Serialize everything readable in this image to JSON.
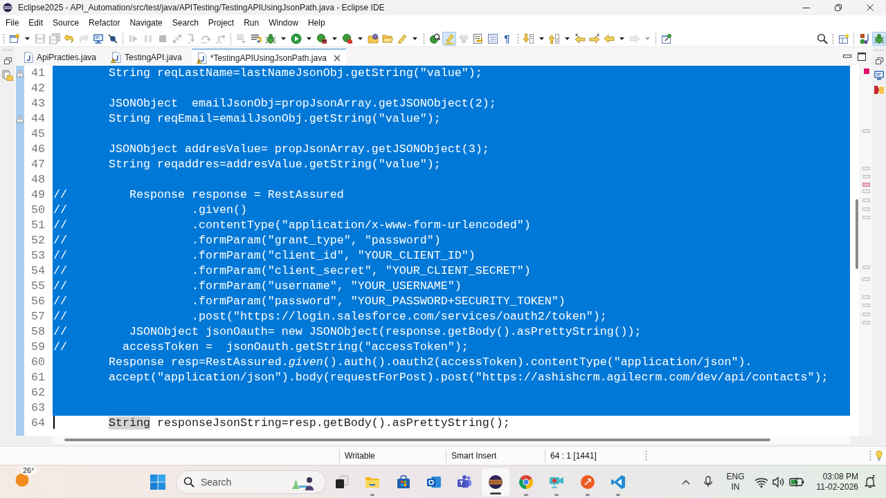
{
  "window": {
    "title": "Eclipse2025 - API_Automation/src/test/java/APITesting/TestingAPIUsingJsonPath.java - Eclipse IDE"
  },
  "menu": [
    "File",
    "Edit",
    "Source",
    "Refactor",
    "Navigate",
    "Search",
    "Project",
    "Run",
    "Window",
    "Help"
  ],
  "toolbar": {
    "sections": [
      {
        "groups": [
          [
            {
              "kind": "new",
              "disabled": false,
              "pressed": false
            },
            {
              "kind": "caret",
              "disabled": false,
              "pressed": false
            },
            {
              "kind": "save",
              "disabled": true,
              "pressed": false
            },
            {
              "kind": "saveall",
              "disabled": true,
              "pressed": false
            },
            {
              "kind": "undo",
              "disabled": false,
              "pressed": false
            },
            {
              "kind": "redo",
              "disabled": true,
              "pressed": false
            },
            {
              "kind": "terminal",
              "disabled": false,
              "pressed": false
            },
            {
              "kind": "skipbreakpoints",
              "disabled": false,
              "pressed": false
            }
          ],
          [
            {
              "kind": "resume",
              "disabled": true,
              "pressed": false
            },
            {
              "kind": "suspend",
              "disabled": true,
              "pressed": false
            },
            {
              "kind": "terminate",
              "disabled": true,
              "pressed": false
            },
            {
              "kind": "disconnect",
              "disabled": true,
              "pressed": false
            },
            {
              "kind": "stepinto",
              "disabled": true,
              "pressed": false
            },
            {
              "kind": "stepover",
              "disabled": true,
              "pressed": false
            },
            {
              "kind": "stepreturn",
              "disabled": true,
              "pressed": false
            }
          ],
          [
            {
              "kind": "stepfilters",
              "disabled": true,
              "pressed": false
            },
            {
              "kind": "dropframe",
              "disabled": false,
              "pressed": false
            },
            {
              "kind": "debug",
              "disabled": false,
              "pressed": false
            },
            {
              "kind": "caret",
              "disabled": false,
              "pressed": false
            },
            {
              "kind": "run",
              "disabled": false,
              "pressed": false
            },
            {
              "kind": "caret",
              "disabled": false,
              "pressed": false
            },
            {
              "kind": "coverage",
              "disabled": false,
              "pressed": false
            },
            {
              "kind": "caret",
              "disabled": false,
              "pressed": false
            },
            {
              "kind": "tools",
              "disabled": false,
              "pressed": false
            },
            {
              "kind": "caret",
              "disabled": false,
              "pressed": false
            },
            {
              "kind": "newpackage",
              "disabled": false,
              "pressed": false
            },
            {
              "kind": "openfolder",
              "disabled": false,
              "pressed": false
            },
            {
              "kind": "pen",
              "disabled": false,
              "pressed": false
            },
            {
              "kind": "caret",
              "disabled": false,
              "pressed": false
            }
          ]
        ]
      },
      {
        "groups": [
          [
            {
              "kind": "task",
              "disabled": false,
              "pressed": false
            },
            {
              "kind": "highlight",
              "disabled": false,
              "pressed": true
            },
            {
              "kind": "balls",
              "disabled": true,
              "pressed": false
            },
            {
              "kind": "wordwrap",
              "disabled": false,
              "pressed": false
            },
            {
              "kind": "blockselect",
              "disabled": false,
              "pressed": false
            },
            {
              "kind": "pilcrow",
              "disabled": false,
              "pressed": false,
              "label": "¶"
            }
          ]
        ]
      },
      {
        "groups": [
          [
            {
              "kind": "nextannotation",
              "disabled": false,
              "pressed": false
            },
            {
              "kind": "caret",
              "disabled": false,
              "pressed": false
            },
            {
              "kind": "previousannotation",
              "disabled": false,
              "pressed": false
            },
            {
              "kind": "caret",
              "disabled": false,
              "pressed": false
            },
            {
              "kind": "lastedit",
              "disabled": false,
              "pressed": false
            },
            {
              "kind": "nextedit",
              "disabled": false,
              "pressed": false
            },
            {
              "kind": "back",
              "disabled": false,
              "pressed": false
            },
            {
              "kind": "caret",
              "disabled": false,
              "pressed": false
            },
            {
              "kind": "forward",
              "disabled": true,
              "pressed": false
            },
            {
              "kind": "caret",
              "disabled": true,
              "pressed": false
            }
          ],
          [
            {
              "kind": "pin",
              "disabled": false,
              "pressed": false
            }
          ]
        ]
      }
    ],
    "search": {
      "kind": "search",
      "disabled": false,
      "pressed": false
    },
    "perspectives": {
      "groups": [
        [
          {
            "kind": "perspective",
            "disabled": false,
            "pressed": false
          }
        ],
        [
          {
            "kind": "javaperspective",
            "disabled": false,
            "pressed": false
          },
          {
            "kind": "debugperspective",
            "disabled": false,
            "pressed": true
          }
        ]
      ]
    }
  },
  "editor_tabs": [
    {
      "label": "ApiPracties.java",
      "selected": false,
      "warning": false
    },
    {
      "label": "TestingAPI.java",
      "selected": false,
      "warning": true
    },
    {
      "label": "*TestingAPIUsingJsonPath.java",
      "selected": true,
      "warning": true
    }
  ],
  "editor": {
    "lines": [
      {
        "number": "41",
        "selected": true,
        "warning": true,
        "caret": false,
        "occurrence": false,
        "code": "        String reqLastName=lastNameJsonObj.getString(\"value\");"
      },
      {
        "number": "42",
        "selected": true,
        "warning": false,
        "caret": false,
        "occurrence": false
      },
      {
        "number": "43",
        "selected": true,
        "warning": false,
        "caret": false,
        "occurrence": false,
        "code": "        JSONObject  emailJsonObj=propJsonArray.getJSONObject(2);"
      },
      {
        "number": "44",
        "selected": true,
        "warning": true,
        "caret": false,
        "occurrence": false,
        "code": "        String reqEmail=emailJsonObj.getString(\"value\");"
      },
      {
        "number": "45",
        "selected": true,
        "warning": false,
        "caret": false,
        "occurrence": false
      },
      {
        "number": "46",
        "selected": true,
        "warning": false,
        "caret": false,
        "occurrence": false,
        "code": "        JSONObject addresValue= propJsonArray.getJSONObject(3);"
      },
      {
        "number": "47",
        "selected": true,
        "warning": false,
        "caret": false,
        "occurrence": false,
        "code": "        String reqaddres=addresValue.getString(\"value\");"
      },
      {
        "number": "48",
        "selected": true,
        "warning": false,
        "caret": false,
        "occurrence": false
      },
      {
        "number": "49",
        "selected": true,
        "warning": false,
        "caret": false,
        "occurrence": false,
        "code": "//         Response response = RestAssured"
      },
      {
        "number": "50",
        "selected": true,
        "warning": false,
        "caret": false,
        "occurrence": false,
        "code": "//                  .given()"
      },
      {
        "number": "51",
        "selected": true,
        "warning": false,
        "caret": false,
        "occurrence": false,
        "code": "//                  .contentType(\"application/x-www-form-urlencoded\")"
      },
      {
        "number": "52",
        "selected": true,
        "warning": false,
        "caret": false,
        "occurrence": false,
        "code": "//                  .formParam(\"grant_type\", \"password\")"
      },
      {
        "number": "53",
        "selected": true,
        "warning": false,
        "caret": false,
        "occurrence": false,
        "code": "//                  .formParam(\"client_id\", \"YOUR_CLIENT_ID\")"
      },
      {
        "number": "54",
        "selected": true,
        "warning": false,
        "caret": false,
        "occurrence": false,
        "code": "//                  .formParam(\"client_secret\", \"YOUR_CLIENT_SECRET\")"
      },
      {
        "number": "55",
        "selected": true,
        "warning": false,
        "caret": false,
        "occurrence": false,
        "code": "//                  .formParam(\"username\", \"YOUR_USERNAME\")"
      },
      {
        "number": "56",
        "selected": true,
        "warning": false,
        "caret": false,
        "occurrence": false,
        "code": "//                  .formParam(\"password\", \"YOUR_PASSWORD+SECURITY_TOKEN\")"
      },
      {
        "number": "57",
        "selected": true,
        "warning": false,
        "caret": false,
        "occurrence": false,
        "code": "//                  .post(\"https://login.salesforce.com/services/oauth2/token\");"
      },
      {
        "number": "58",
        "selected": true,
        "warning": false,
        "caret": false,
        "occurrence": false,
        "code": "//         JSONObject jsonOauth= new JSONObject(response.getBody().asPrettyString());"
      },
      {
        "number": "59",
        "selected": true,
        "warning": false,
        "caret": false,
        "occurrence": false,
        "code": "//        accessToken =  jsonOauth.getString(\"accessToken\");"
      },
      {
        "number": "60",
        "selected": true,
        "warning": false,
        "caret": false,
        "occurrence": false,
        "code": "        Response resp=RestAssured.*given*().auth().oauth2(accessToken).contentType(\"application/json\")."
      },
      {
        "number": "61",
        "selected": true,
        "warning": false,
        "caret": false,
        "occurrence": false,
        "code": "        accept(\"application/json\").body(requestForPost).post(\"https://ashishcrm.agilecrm.com/dev/api/contacts\");"
      },
      {
        "number": "62",
        "selected": true,
        "warning": false,
        "caret": false,
        "occurrence": false
      },
      {
        "number": "63",
        "selected": true,
        "warning": false,
        "caret": false,
        "occurrence": false
      },
      {
        "number": "64",
        "selected": false,
        "warning": false,
        "caret": true,
        "occurrence": true,
        "code": "        String responseJsonString=resp.getBody().asPrettyString();"
      }
    ]
  },
  "status_bar": {
    "write_mode": "Writable",
    "insert_mode": "Smart Insert",
    "position": "64 : 1 [1441]"
  },
  "taskbar": {
    "weather": {
      "temperature": "26°"
    },
    "search": {
      "placeholder": "Search"
    },
    "apps": [
      {
        "kind": "taskview",
        "running": false,
        "selected": false
      },
      {
        "kind": "explorer",
        "running": true,
        "selected": false
      },
      {
        "kind": "store",
        "running": false,
        "selected": false
      },
      {
        "kind": "mail",
        "running": false,
        "selected": false
      },
      {
        "kind": "teams",
        "running": false,
        "selected": false
      },
      {
        "kind": "eclipse",
        "running": true,
        "selected": true
      },
      {
        "kind": "browser",
        "running": true,
        "selected": false
      },
      {
        "kind": "camera",
        "running": true,
        "selected": false
      },
      {
        "kind": "api",
        "running": true,
        "selected": false
      },
      {
        "kind": "code",
        "running": true,
        "selected": false
      }
    ],
    "tray": {
      "language": "ENG",
      "region": "IN",
      "time": "03:08 PM",
      "date": "11-02-2026"
    }
  }
}
